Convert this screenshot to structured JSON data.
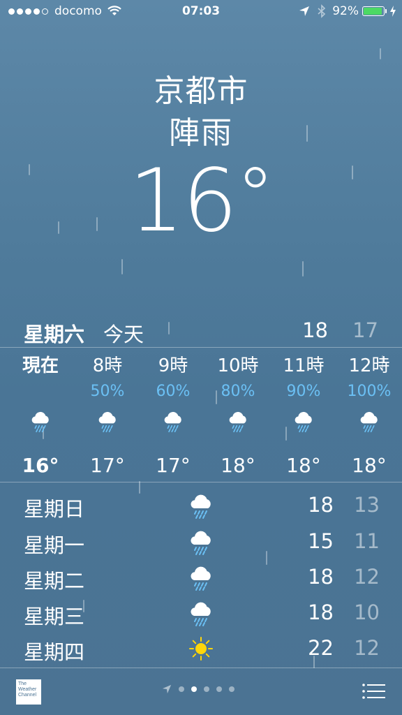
{
  "status_bar": {
    "carrier": "docomo",
    "time": "07:03",
    "battery": "92%",
    "battery_level": 0.92,
    "signal_bars": 4
  },
  "location": {
    "city": "京都市",
    "condition": "陣雨",
    "temperature": "16",
    "degree": "°"
  },
  "today": {
    "day": "星期六",
    "label": "今天",
    "high": "18",
    "low": "17"
  },
  "hourly": [
    {
      "time": "現在",
      "pop": "",
      "icon": "rain-cloud-icon",
      "temp": "16°"
    },
    {
      "time": "8時",
      "pop": "50%",
      "icon": "rain-cloud-icon",
      "temp": "17°"
    },
    {
      "time": "9時",
      "pop": "60%",
      "icon": "rain-cloud-icon",
      "temp": "17°"
    },
    {
      "time": "10時",
      "pop": "80%",
      "icon": "rain-cloud-icon",
      "temp": "18°"
    },
    {
      "time": "11時",
      "pop": "90%",
      "icon": "rain-cloud-icon",
      "temp": "18°"
    },
    {
      "time": "12時",
      "pop": "100%",
      "icon": "rain-cloud-icon",
      "temp": "18°"
    }
  ],
  "daily": [
    {
      "day": "星期日",
      "icon": "rain-cloud-icon",
      "high": "18",
      "low": "13"
    },
    {
      "day": "星期一",
      "icon": "rain-cloud-icon",
      "high": "15",
      "low": "11"
    },
    {
      "day": "星期二",
      "icon": "rain-cloud-icon",
      "high": "18",
      "low": "12"
    },
    {
      "day": "星期三",
      "icon": "rain-cloud-icon",
      "high": "18",
      "low": "10"
    },
    {
      "day": "星期四",
      "icon": "sun-icon",
      "high": "22",
      "low": "12"
    }
  ],
  "footer": {
    "logo_text": [
      "The",
      "Weather",
      "Channel"
    ],
    "page_count": 5,
    "active_page": 1
  },
  "colors": {
    "precip": "#6bc0f4",
    "sun": "#ffd60a",
    "battery": "#4cd964"
  }
}
